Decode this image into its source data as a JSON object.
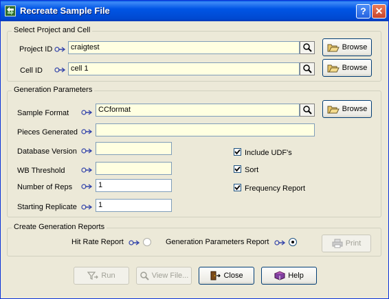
{
  "window": {
    "title": "Recreate Sample File",
    "help_btn": "?",
    "close_btn": "✕"
  },
  "project_group": {
    "title": "Select Project and Cell",
    "project_label": "Project ID",
    "project_value": "craigtest",
    "cell_label": "Cell ID",
    "cell_value": "cell 1",
    "browse_label": "Browse"
  },
  "generation_group": {
    "title": "Generation Parameters",
    "sample_format_label": "Sample Format",
    "sample_format_value": "CCformat",
    "pieces_label": "Pieces Generated",
    "pieces_value": "",
    "db_version_label": "Database Version",
    "db_version_value": "",
    "wb_threshold_label": "WB Threshold",
    "wb_threshold_value": "",
    "num_reps_label": "Number of Reps",
    "num_reps_value": "1",
    "start_rep_label": "Starting Replicate",
    "start_rep_value": "1",
    "browse_label": "Browse",
    "include_udf_label": "Include UDF's",
    "include_udf_checked": true,
    "sort_label": "Sort",
    "sort_checked": true,
    "freq_report_label": "Frequency Report",
    "freq_report_checked": true
  },
  "reports_group": {
    "title": "Create Generation Reports",
    "hit_rate_label": "Hit Rate Report",
    "gen_params_label": "Generation Parameters Report",
    "selected_report": "Generation Parameters Report",
    "print_label": "Print"
  },
  "footer": {
    "run_label": "Run",
    "view_file_label": "View File...",
    "close_label": "Close",
    "help_label": "Help"
  },
  "colors": {
    "field_bg": "#ffffe1",
    "window_bg": "#ece9d8",
    "titlebar": "#0055e5"
  }
}
